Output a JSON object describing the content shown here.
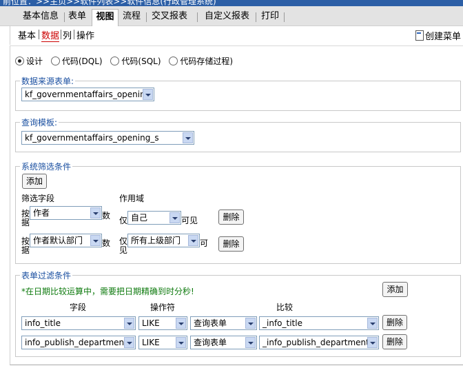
{
  "breadcrumb": "前位置：>>主页>>软件列表>>软件信息(行政管理系统)",
  "main_tabs": [
    "基本信息",
    "表单",
    "视图",
    "流程",
    "交叉报表",
    "自定义报表",
    "打印"
  ],
  "sub_tabs": [
    "基本",
    "数据",
    "列",
    "操作"
  ],
  "create_menu": "创建菜单",
  "source_options": [
    "设计",
    "代码(DQL)",
    "代码(SQL)",
    "代码存储过程)"
  ],
  "datasource": {
    "legend": "数据来源表单:",
    "value": "kf_governmentaffairs_opening"
  },
  "query_template": {
    "legend": "查询模板:",
    "value": "kf_governmentaffairs_opening_s"
  },
  "system_filter": {
    "legend": "系统筛选条件",
    "add": "添加",
    "col_field": "筛选字段",
    "col_scope": "作用域",
    "rows": [
      {
        "prefix": "按据",
        "field": "作者",
        "suffix": "数",
        "scope_prefix": "仅",
        "scope": "自己",
        "scope_suffix": "可见",
        "delete": "删除"
      },
      {
        "prefix": "按据",
        "field": "作者默认部门",
        "suffix": "数",
        "scope_prefix": "仅见",
        "scope": "所有上级部门",
        "scope_suffix": "可",
        "delete": "删除"
      }
    ]
  },
  "form_filter": {
    "legend": "表单过滤条件",
    "note": "*在日期比较运算中，需要把日期精确到时分秒!",
    "add": "添加",
    "col_field": "字段",
    "col_op": "操作符",
    "col_compare": "比较",
    "rows": [
      {
        "field": "info_title",
        "op": "LIKE",
        "target": "查询表单",
        "compare": "_info_title",
        "delete": "删除"
      },
      {
        "field": "info_publish_department",
        "op": "LIKE",
        "target": "查询表单",
        "compare": "_info_publish_department",
        "delete": "删除"
      }
    ]
  },
  "colors": {
    "accent": "#1a4fa0",
    "note": "#0e7a0e",
    "active_subtab": "#cc0000"
  }
}
